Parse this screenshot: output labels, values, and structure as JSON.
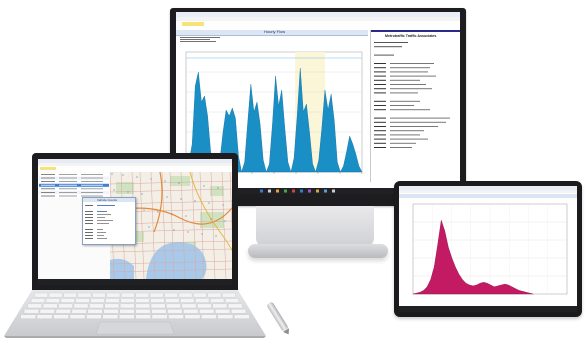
{
  "scene": {
    "description_colors": {
      "desk_background": "#ffffff",
      "device_black": "#1d1d1f",
      "chart_blue": "#1a8fc6",
      "chart_magenta": "#c21a63",
      "map_green": "#cfe3c0",
      "water_blue": "#a8c9ea"
    }
  },
  "monitor": {
    "panel_title": "Hourly Flow",
    "report_heading": "Metrotraffic Traffic Associates",
    "chart_data": {
      "type": "area",
      "series": [
        {
          "values": [
            0,
            5,
            14,
            43,
            50,
            35,
            38,
            28,
            10,
            3,
            0,
            6,
            20,
            31,
            28,
            32,
            27,
            8,
            0,
            5,
            25,
            44,
            30,
            35,
            24,
            6,
            0,
            4,
            24,
            48,
            33,
            41,
            22,
            5,
            0,
            7,
            28,
            52,
            30,
            34,
            20,
            4,
            0,
            6,
            22,
            41,
            31,
            39,
            26,
            5,
            0,
            3,
            10,
            18,
            14,
            9,
            3,
            0
          ]
        }
      ],
      "ylim": [
        0,
        60
      ]
    }
  },
  "laptop": {
    "panel_title": "Vehicle Counts",
    "window_label": "Map View"
  },
  "tablet": {
    "chart_data": {
      "type": "area",
      "series": [
        {
          "values": [
            0,
            1,
            2,
            4,
            8,
            16,
            30,
            55,
            82,
            70,
            52,
            40,
            30,
            22,
            16,
            12,
            10,
            9,
            10,
            12,
            13,
            12,
            10,
            8,
            9,
            10,
            11,
            10,
            8,
            6,
            4,
            3,
            2,
            1,
            0
          ]
        }
      ],
      "ylim": [
        0,
        100
      ]
    }
  }
}
